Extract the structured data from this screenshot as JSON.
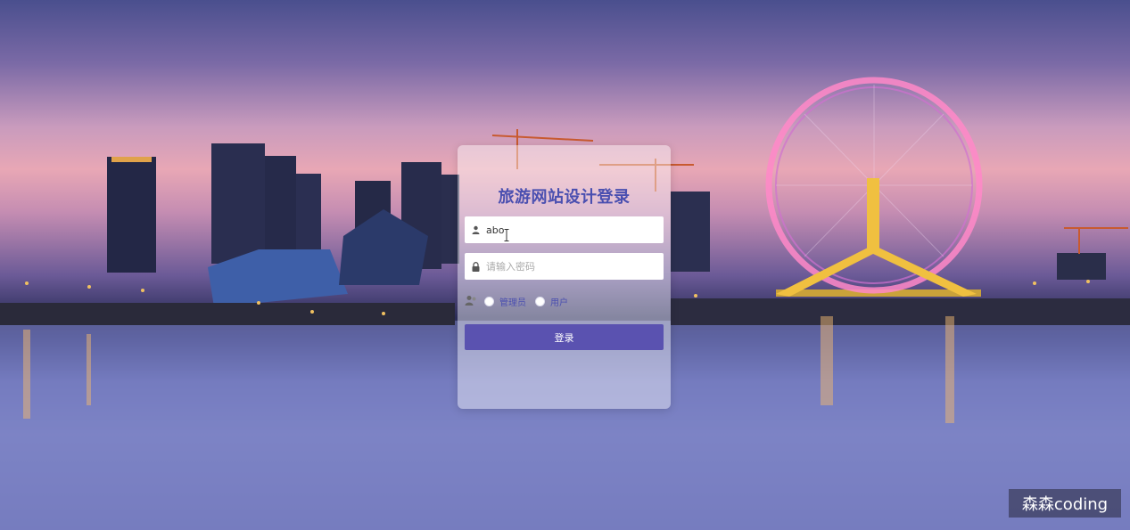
{
  "login": {
    "title": "旅游网站设计登录",
    "username": {
      "value": "abo",
      "icon": "user-icon"
    },
    "password": {
      "placeholder": "请输入密码",
      "icon": "lock-icon"
    },
    "roles": {
      "icon": "role-icon",
      "options": [
        {
          "label": "管理员"
        },
        {
          "label": "用户"
        }
      ]
    },
    "submit_label": "登录"
  },
  "watermark": {
    "text": "森森coding"
  },
  "colors": {
    "accent": "#5a52b0",
    "title": "#4a4fb0"
  }
}
